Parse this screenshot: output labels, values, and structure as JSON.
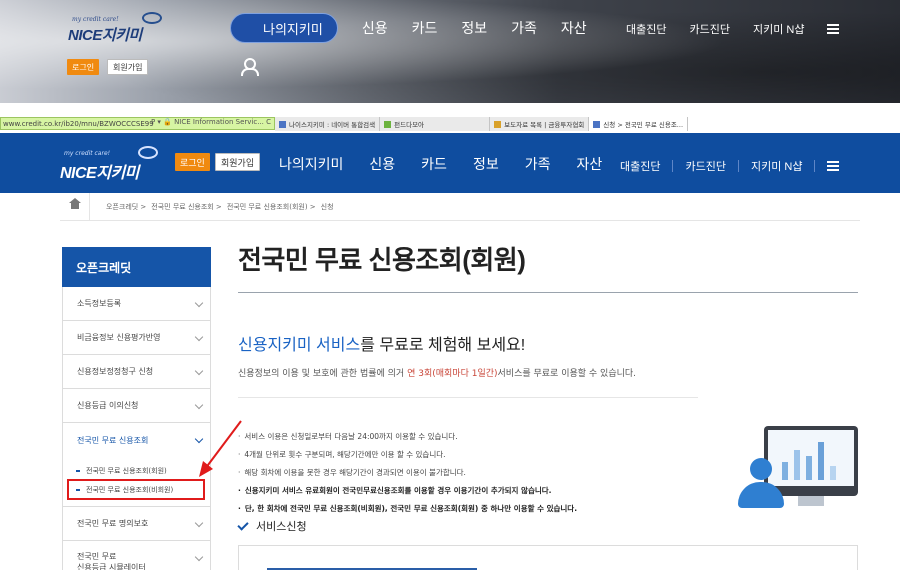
{
  "hero": {
    "logo_tag": "my credit care!",
    "logo_brand": "NICE지키미",
    "pill_label": "나의지키미",
    "menu": [
      "신용",
      "카드",
      "정보",
      "가족",
      "자산"
    ],
    "right_links": [
      "대출진단",
      "카드진단",
      "지키미 N샵"
    ],
    "login": "로그인",
    "join": "회원가입"
  },
  "browser": {
    "address": "www.credit.co.kr/ib20/mnu/BZWOCCCSE99",
    "address_tail": "P ▾ 🔒 NICE Information Servic... C",
    "tabs": [
      "나이스지키미 : 네이버 통합검색",
      "펀드다모아",
      "보도자료 목록 | 금융투자협회",
      "신청 > 전국민 무료 신용조..."
    ]
  },
  "site": {
    "logo_tag": "my credit care!",
    "logo_brand": "NICE지키미",
    "login": "로그인",
    "join": "회원가입",
    "menu": [
      "나의지키미",
      "신용",
      "카드",
      "정보",
      "가족",
      "자산"
    ],
    "right_links": [
      "대출진단",
      "카드진단",
      "지키미 N샵"
    ]
  },
  "breadcrumb": [
    "오픈크레딧 >",
    "전국민 무료 신용조회 >",
    "전국민 무료 신용조회(회원) >",
    "신청"
  ],
  "sidebar": {
    "title": "오픈크레딧",
    "items": [
      "소득정보등록",
      "비금융정보 신용평가반영",
      "신용정보정정청구 신청",
      "신용등급 이의신청",
      "전국민 무료 신용조회",
      "전국민 무료 명의보호",
      "전국민 무료"
    ],
    "last_item_line2": "신용등급 시뮬레이터",
    "sub_items": [
      "전국민 무료 신용조회(회원)",
      "전국민 무료 신용조회(비회원)"
    ]
  },
  "main": {
    "title": "전국민 무료 신용조회(회원)",
    "headline_blue": "신용지키미 서비스",
    "headline_rest": "를 무료로 체험해 보세요!",
    "intro_pre": "신용정보의 이용 및 보호에 관한 법률에 의거 ",
    "intro_highlight": "연 3회(매회마다 1일간)",
    "intro_post": "서비스를 무료로 이용할 수 있습니다.",
    "bullets": [
      "서비스 이용은 신청일로부터 다음날 24:00까지 이용할 수 있습니다.",
      "4개월 단위로 횟수 구분되며, 해당기간에만 이용 할 수 있습니다.",
      "해당 회차에 이용을 못한 경우 해당기간이 경과되면 이용이 불가합니다.",
      "신용지키미 서비스 유료회원이 전국민무료신용조회를 이용할 경우 이용기간이 추가되지 않습니다.",
      "단, 한 회차에 전국민 무료 신용조회(비회원), 전국민 무료 신용조회(회원) 중 하나만 이용할 수 있습니다."
    ],
    "apply_label": "서비스신청"
  },
  "colors": {
    "brand_blue": "#0f4d9f",
    "accent_orange": "#f08a10",
    "highlight_red": "#c9473a",
    "annotation_red": "#e01b1b"
  }
}
